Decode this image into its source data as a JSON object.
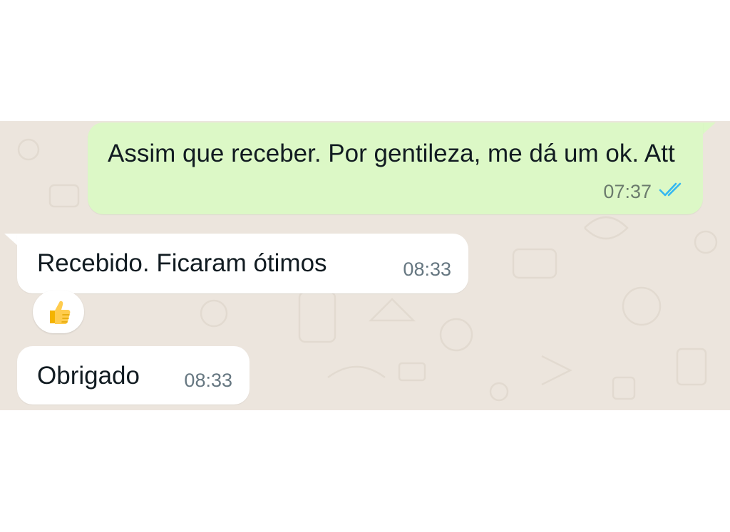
{
  "messages": {
    "outgoing": {
      "text": "Assim que receber. Por gentileza, me dá um ok. Att",
      "time": "07:37",
      "status_icon": "double-check-read-icon",
      "bubble_color": "#dcf8c6",
      "tick_color": "#34b7f1"
    },
    "incoming_1": {
      "text": "Recebido. Ficaram ótimos",
      "time": "08:33",
      "reaction_icon": "thumbs-up-icon"
    },
    "incoming_2": {
      "text": "Obrigado",
      "time": "08:33"
    }
  },
  "wallpaper_color": "#ece5dd"
}
